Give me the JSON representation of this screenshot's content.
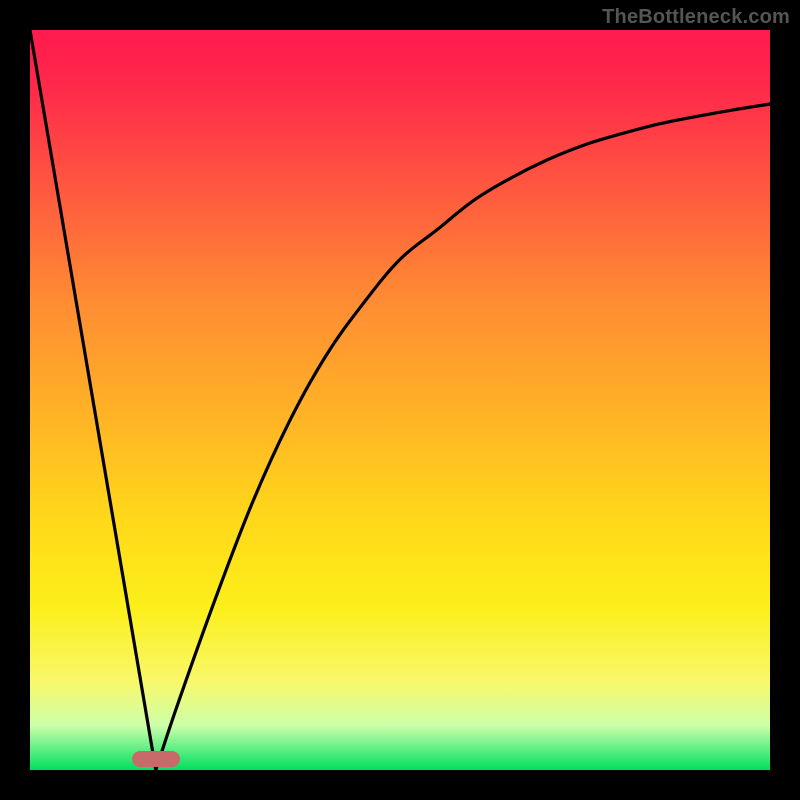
{
  "watermark": "TheBottleneck.com",
  "chart_data": {
    "type": "line",
    "title": "",
    "xlabel": "",
    "ylabel": "",
    "xlim": [
      0,
      100
    ],
    "ylim": [
      0,
      100
    ],
    "series": [
      {
        "name": "left-line",
        "x": [
          0,
          17
        ],
        "y": [
          100,
          0
        ]
      },
      {
        "name": "right-curve",
        "x": [
          17,
          20,
          25,
          30,
          35,
          40,
          45,
          50,
          55,
          60,
          65,
          70,
          75,
          80,
          85,
          90,
          95,
          100
        ],
        "y": [
          0,
          9,
          23,
          36,
          47,
          56,
          63,
          69,
          73,
          77,
          80,
          82.5,
          84.5,
          86,
          87.3,
          88.3,
          89.2,
          90
        ]
      }
    ],
    "marker": {
      "x": 17,
      "y": 1.5
    },
    "gradient_stops": [
      {
        "pos": 0,
        "color": "#ff1a4e"
      },
      {
        "pos": 0.5,
        "color": "#ffd81a"
      },
      {
        "pos": 1,
        "color": "#00e060"
      }
    ]
  }
}
